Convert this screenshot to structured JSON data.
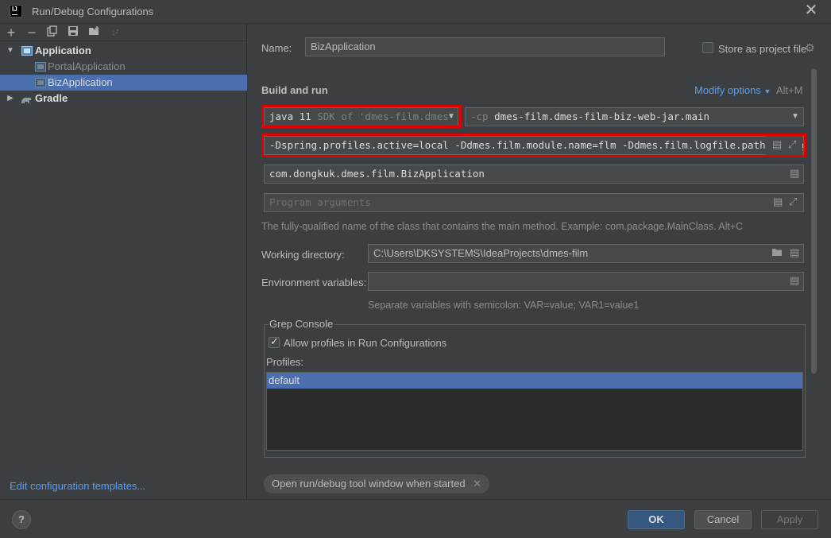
{
  "window": {
    "title": "Run/Debug Configurations",
    "logo": "IJ"
  },
  "toolbar": {
    "icons": [
      "add-icon",
      "remove-icon",
      "copy-icon",
      "save-icon",
      "new-folder-icon",
      "sort-icon"
    ]
  },
  "tree": {
    "items": [
      {
        "label": "Application"
      },
      {
        "label": "PortalApplication"
      },
      {
        "label": "BizApplication"
      },
      {
        "label": "Gradle"
      }
    ]
  },
  "left_footer": {
    "edit_templates": "Edit configuration templates..."
  },
  "form": {
    "name_label": "Name:",
    "name_value": "BizApplication",
    "store_label": "Store as project file",
    "section_title": "Build and run",
    "modify_options": "Modify options",
    "modify_shortcut": "Alt+M",
    "jdk_value": "java 11",
    "jdk_detail": "SDK of 'dmes-film.dmes-",
    "cp_prefix": "-cp",
    "cp_value": "dmes-film.dmes-film-biz-web-jar.main",
    "vm_options": "-Dspring.profiles.active=local -Ddmes.film.module.name=flm -Ddmes.film.logfile.path=c:/log",
    "main_class": "com.dongkuk.dmes.film.BizApplication",
    "program_args_placeholder": "Program arguments",
    "main_class_hint": "The fully-qualified name of the class that contains the main method. Example: com.package.MainClass. Alt+C",
    "workdir_label": "Working directory:",
    "workdir_value": "C:\\Users\\DKSYSTEMS\\IdeaProjects\\dmes-film",
    "env_label": "Environment variables:",
    "env_value": "",
    "env_hint": "Separate variables with semicolon: VAR=value; VAR1=value1"
  },
  "grep_console": {
    "title": "Grep Console",
    "allow_label": "Allow profiles in Run Configurations",
    "allow_checked": true,
    "profiles_label": "Profiles:",
    "profiles": [
      "default"
    ]
  },
  "chip": {
    "label": "Open run/debug tool window when started"
  },
  "buttons": {
    "help": "?",
    "ok": "OK",
    "cancel": "Cancel",
    "apply": "Apply"
  },
  "colors": {
    "accent": "#4b6eaf",
    "link": "#589df6",
    "highlight": "#e00000",
    "background": "#3c3f41"
  }
}
